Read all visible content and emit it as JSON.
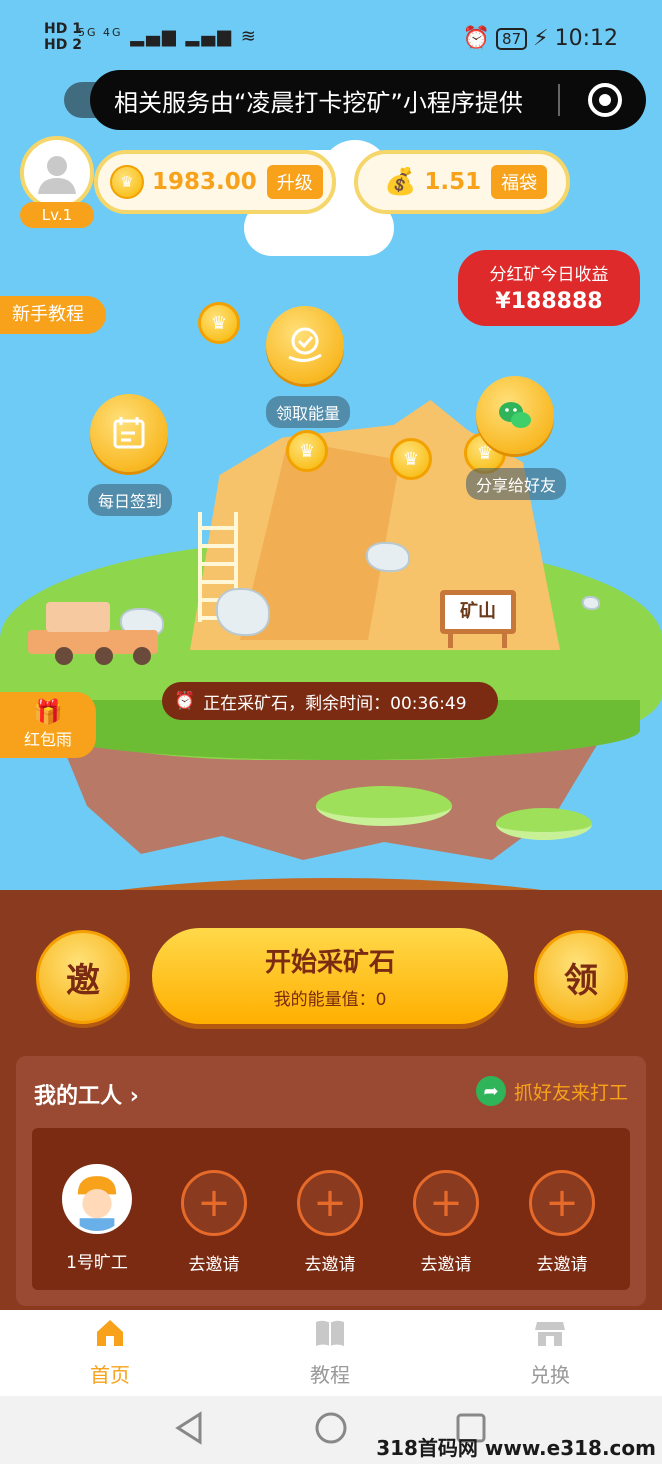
{
  "statusbar": {
    "hd1": "HD 1",
    "hd2": "HD 2",
    "signal": "5G 4G",
    "battery": "87",
    "time": "10:12"
  },
  "banner": {
    "text": "相关服务由“凌晨打卡挖矿”小程序提供"
  },
  "user": {
    "level": "Lv.1"
  },
  "coins": {
    "value": "1983.00",
    "button": "升级"
  },
  "bag": {
    "value": "1.51",
    "button": "福袋"
  },
  "bonus": {
    "title": "分红矿今日收益",
    "value": "¥188888"
  },
  "tabs": {
    "tutorial": "新手教程",
    "redpack": "红包雨"
  },
  "actions": {
    "energy": "领取能量",
    "checkin": "每日签到",
    "share": "分享给好友"
  },
  "island": {
    "sign": "矿山"
  },
  "timer": {
    "text": "正在采矿石，剩余时间：00:36:49"
  },
  "controls": {
    "invite": "邀",
    "claim": "领",
    "start": "开始采矿石",
    "energy": "我的能量值：0"
  },
  "workers": {
    "title": "我的工人",
    "title_chevron": "›",
    "link": "抓好友来打工",
    "slots": [
      {
        "label": "1号旷工"
      },
      {
        "label": "去邀请"
      },
      {
        "label": "去邀请"
      },
      {
        "label": "去邀请"
      },
      {
        "label": "去邀请"
      }
    ]
  },
  "nav": [
    {
      "label": "首页"
    },
    {
      "label": "教程"
    },
    {
      "label": "兑换"
    }
  ],
  "watermark": "318首码网 www.e318.com",
  "colors": {
    "accent": "#f7a21a",
    "brown": "#7a2b12",
    "sky": "#6ecbf5",
    "red": "#de2a2a"
  }
}
